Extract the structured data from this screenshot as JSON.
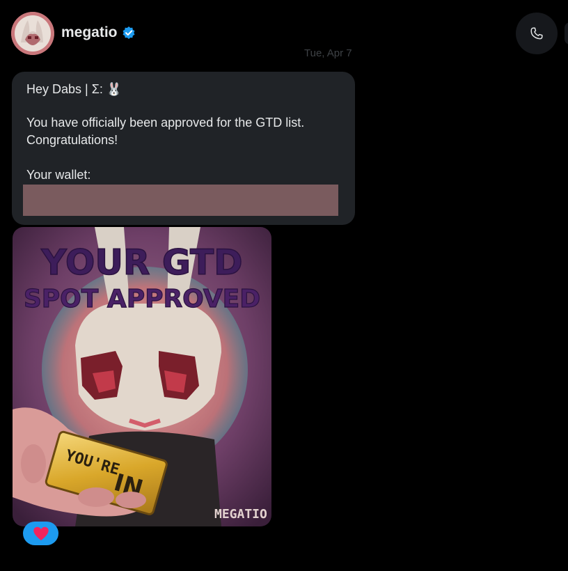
{
  "conversation": {
    "username": "megatio",
    "verified": true,
    "date_separator": "Tue, Apr 7"
  },
  "message": {
    "greeting": "Hey Dabs | Σ: 🐰",
    "line1": "You have officially been approved for the GTD list.",
    "line2": "Congratulations!",
    "wallet_label": "Your wallet:"
  },
  "image": {
    "headline1": "YOUR GTD",
    "headline2": "SPOT APPROVED",
    "ticket_text1": "YOU'RE",
    "ticket_text2": "IN",
    "signature": "MEGATIO"
  },
  "reaction": {
    "emoji": "heart"
  },
  "colors": {
    "background": "#000000",
    "bubble": "#202327",
    "accent": "#1d9bf0",
    "redaction": "#7a5b5e"
  },
  "icons": [
    "verified-badge-icon",
    "phone-icon",
    "heart-icon"
  ]
}
